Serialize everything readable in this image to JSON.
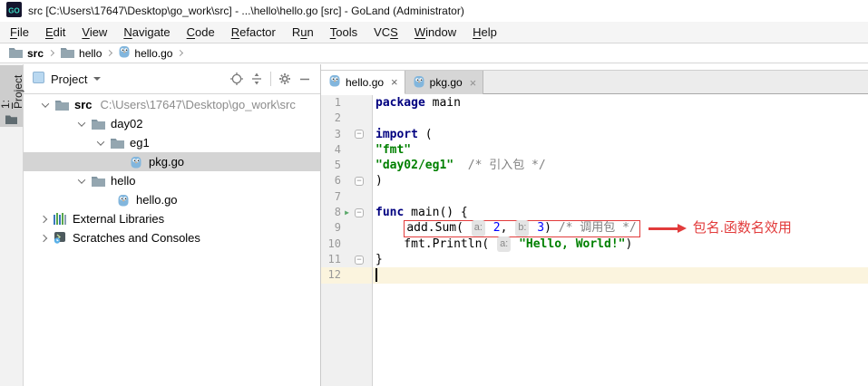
{
  "colors": {
    "annotation_red": "#e23b3b",
    "keyword": "#000080",
    "string": "#008000",
    "number": "#0000ff",
    "comment": "#808080",
    "tree_selection": "#d4d4d4",
    "current_line": "#fbf4de",
    "run_arrow_green": "#59a869",
    "go_icon_blue": "#82b6dd"
  },
  "glyphs": {
    "close": "×",
    "fold": "−",
    "run": "▶",
    "logo_text": "GO"
  },
  "window": {
    "title": "src [C:\\Users\\17647\\Desktop\\go_work\\src] - ...\\hello\\hello.go [src] - GoLand (Administrator)"
  },
  "menubar": {
    "items": [
      {
        "label": "File",
        "m": 0
      },
      {
        "label": "Edit",
        "m": 0
      },
      {
        "label": "View",
        "m": 0
      },
      {
        "label": "Navigate",
        "m": 0
      },
      {
        "label": "Code",
        "m": 0
      },
      {
        "label": "Refactor",
        "m": 0
      },
      {
        "label": "Run",
        "m": 1
      },
      {
        "label": "Tools",
        "m": 0
      },
      {
        "label": "VCS",
        "m": 2
      },
      {
        "label": "Window",
        "m": 0
      },
      {
        "label": "Help",
        "m": 0
      }
    ]
  },
  "breadcrumbs": {
    "items": [
      {
        "label": "src",
        "icon": "folder",
        "bold": true
      },
      {
        "label": "hello",
        "icon": "folder",
        "bold": false
      },
      {
        "label": "hello.go",
        "icon": "go-file",
        "bold": false
      }
    ]
  },
  "tool_strip": {
    "tab_label": "1: Project",
    "m": 0
  },
  "project_panel": {
    "title": "Project",
    "header_icons": [
      "locate-icon",
      "collapse-all-icon",
      "divider",
      "settings-gear-icon",
      "hide-icon"
    ],
    "tree": [
      {
        "pad": 18,
        "chev": "down",
        "icon": "folder",
        "label": "src",
        "bold": true,
        "extra": "C:\\Users\\17647\\Desktop\\go_work\\src",
        "selected": false
      },
      {
        "pad": 58,
        "chev": "down",
        "icon": "folder",
        "label": "day02",
        "selected": false
      },
      {
        "pad": 79,
        "chev": "down",
        "icon": "folder",
        "label": "eg1",
        "selected": false
      },
      {
        "pad": 100,
        "chev": null,
        "icon": "go-file",
        "label": "pkg.go",
        "selected": true
      },
      {
        "pad": 58,
        "chev": "down",
        "icon": "folder",
        "label": "hello",
        "selected": false
      },
      {
        "pad": 86,
        "chev": null,
        "icon": "go-file",
        "label": "hello.go",
        "selected": false
      },
      {
        "pad": 16,
        "chev": "right",
        "icon": "libraries",
        "label": "External Libraries",
        "selected": false
      },
      {
        "pad": 16,
        "chev": "right",
        "icon": "scratches",
        "label": "Scratches and Consoles",
        "selected": false
      }
    ]
  },
  "editor": {
    "tabs": [
      {
        "label": "hello.go",
        "icon": "go-file",
        "active": true
      },
      {
        "label": "pkg.go",
        "icon": "go-file",
        "active": false
      }
    ],
    "annotation": {
      "text": "包名.函数名效用"
    },
    "lines": [
      {
        "n": 1,
        "tokens": [
          {
            "t": "package",
            "c": "kw"
          },
          {
            "t": " main",
            "c": "pl"
          }
        ]
      },
      {
        "n": 2,
        "tokens": []
      },
      {
        "n": 3,
        "fold": true,
        "tokens": [
          {
            "t": "import",
            "c": "kw"
          },
          {
            "t": " (",
            "c": "pl"
          }
        ]
      },
      {
        "n": 4,
        "tokens": [
          {
            "t": "\"fmt\"",
            "c": "str"
          }
        ]
      },
      {
        "n": 5,
        "tokens": [
          {
            "t": "\"day02/eg1\"",
            "c": "str"
          },
          {
            "t": "  ",
            "c": "pl"
          },
          {
            "t": "/* 引入包 */",
            "c": "cmt"
          }
        ]
      },
      {
        "n": 6,
        "fold": true,
        "tokens": [
          {
            "t": ")",
            "c": "pl"
          }
        ]
      },
      {
        "n": 7,
        "tokens": []
      },
      {
        "n": 8,
        "fold": true,
        "run": true,
        "tokens": [
          {
            "t": "func",
            "c": "kw"
          },
          {
            "t": " main() {",
            "c": "pl"
          }
        ]
      },
      {
        "n": 9,
        "ann": true,
        "tokens": [
          {
            "t": "    ",
            "c": "pl"
          },
          {
            "c": "box",
            "tokens": [
              {
                "t": "add.Sum( ",
                "c": "pl"
              },
              {
                "t": "a:",
                "c": "hint"
              },
              {
                "t": " ",
                "c": "pl"
              },
              {
                "t": "2",
                "c": "num"
              },
              {
                "t": ", ",
                "c": "pl"
              },
              {
                "t": "b:",
                "c": "hint"
              },
              {
                "t": " ",
                "c": "pl"
              },
              {
                "t": "3",
                "c": "num"
              },
              {
                "t": ") ",
                "c": "pl"
              },
              {
                "t": "/* 调用包 */",
                "c": "cmt"
              }
            ]
          }
        ]
      },
      {
        "n": 10,
        "tokens": [
          {
            "t": "    fmt.Println( ",
            "c": "pl"
          },
          {
            "t": "a:",
            "c": "hint"
          },
          {
            "t": " ",
            "c": "pl"
          },
          {
            "t": "\"Hello, World!\"",
            "c": "str"
          },
          {
            "t": ")",
            "c": "pl"
          }
        ]
      },
      {
        "n": 11,
        "fold": true,
        "tokens": [
          {
            "t": "}",
            "c": "pl"
          }
        ]
      },
      {
        "n": 12,
        "current": true,
        "caret": true,
        "tokens": []
      }
    ]
  }
}
